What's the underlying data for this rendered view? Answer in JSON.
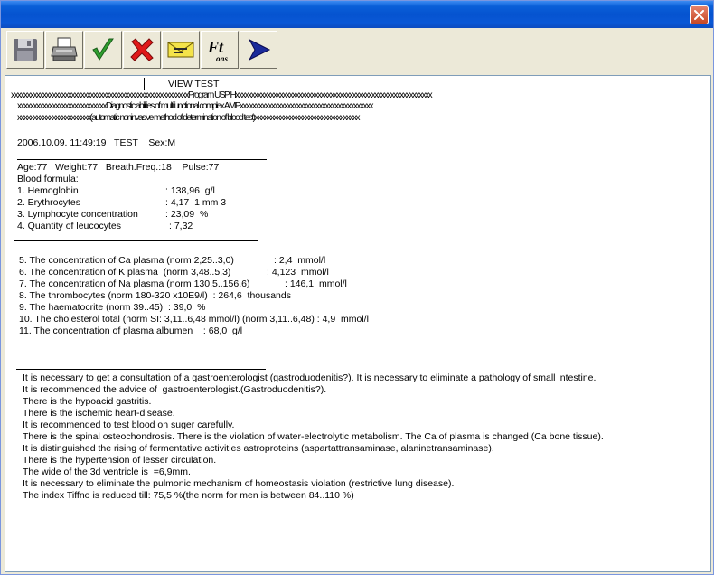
{
  "window": {
    "title": ""
  },
  "toolbar": {
    "buttons": [
      {
        "name": "save-button",
        "icon": "floppy-disk-icon"
      },
      {
        "name": "print-button",
        "icon": "printer-icon"
      },
      {
        "name": "accept-button",
        "icon": "green-checkmark-icon"
      },
      {
        "name": "reject-button",
        "icon": "red-cross-icon"
      },
      {
        "name": "mail-button",
        "icon": "envelope-icon"
      },
      {
        "name": "font-button",
        "icon": "font-icon"
      },
      {
        "name": "send-button",
        "icon": "blue-arrow-icon"
      }
    ],
    "font_label": "Ft",
    "font_sub": "ons"
  },
  "report": {
    "header_line": "VIEW TEST",
    "program_line": "xxxxxxxxxxxxxxxxxxxxxxxxxxxxxxxxxxxxxxxxxxxxxxxxxxxxxxxxProgram USPIHxxxxxxxxxxxxxxxxxxxxxxxxxxxxxxxxxxxxxxxxxxxxxxxxxxxxxxxxxxxxxx",
    "diag_line": "xxxxxxxxxxxxxxxxxxxxxxxxxxxxDiagnostic abilities of multifunctional complex AMPxxxxxxxxxxxxxxxxxxxxxxxxxxxxxxxxxxxxxxxxxx",
    "method_line": "xxxxxxxxxxxxxxxxxxxxxxx(automatic noninvasive method of determination of blood test)xxxxxxxxxxxxxxxxxxxxxxxxxxxxxxxxx",
    "date_line": "2006.10.09. 11:49:19   TEST    Sex:M",
    "stats_line": "Age:77   Weight:77   Breath.Freq.:18    Pulse:77",
    "blood_formula_label": "Blood formula:",
    "formula": [
      {
        "name": "1. Hemoglobin",
        "value": ": 138,96  g/l"
      },
      {
        "name": "2. Erythrocytes",
        "value": ": 4,17  1 mm 3"
      },
      {
        "name": "3. Lymphocyte concentration",
        "value": ": 23,09  %"
      },
      {
        "name": "4. Quantity of leucocytes",
        "value": ": 7,32"
      }
    ],
    "plasma": [
      {
        "name": "5. The concentration of Ca plasma (norm 2,25..3,0)",
        "value": ": 2,4  mmol/l"
      },
      {
        "name": "6. The concentration of K plasma  (norm 3,48..5,3)",
        "value": ": 4,123  mmol/l"
      },
      {
        "name": "7. The concentration of Na plasma (norm 130,5..156,6)",
        "value": ": 146,1  mmol/l"
      }
    ],
    "plasma_inline": [
      "8. The thrombocytes (norm 180-320 x10E9/l)  : 264,6  thousands",
      "9. The haematocrite (norm 39..45)  : 39,0  %",
      "10. The cholesterol total (norm SI: 3,11..6,48 mmol/l) (norm 3,11..6,48) : 4,9  mmol/l",
      "11. The concentration of plasma albumen    : 68,0  g/l"
    ],
    "conclusions": [
      "It is necessary to get a consultation of a gastroenterologist (gastroduodenitis?). It is necessary to eliminate a pathology of small intestine.",
      "It is recommended the advice of  gastroenterologist.(Gastroduodenitis?).",
      "There is the hypoacid gastritis.",
      "There is the ischemic heart-disease.",
      "It is recommended to test blood on suger carefully.",
      "There is the spinal osteochondrosis. There is the violation of water-electrolytic metabolism. The Ca of plasma is changed (Ca bone tissue).",
      "It is distinguished the rising of fermentative activities astroproteins (aspartattransaminase, alaninetransaminase).",
      "There is the hypertension of lesser circulation.",
      "The wide of the 3d ventricle is  =6,9mm.",
      "It is necessary to eliminate the pulmonic mechanism of homeostasis violation (restrictive lung disease).",
      "The index Tiffno is reduced till: 75,5 %(the norm for men is between 84..110 %)"
    ]
  }
}
